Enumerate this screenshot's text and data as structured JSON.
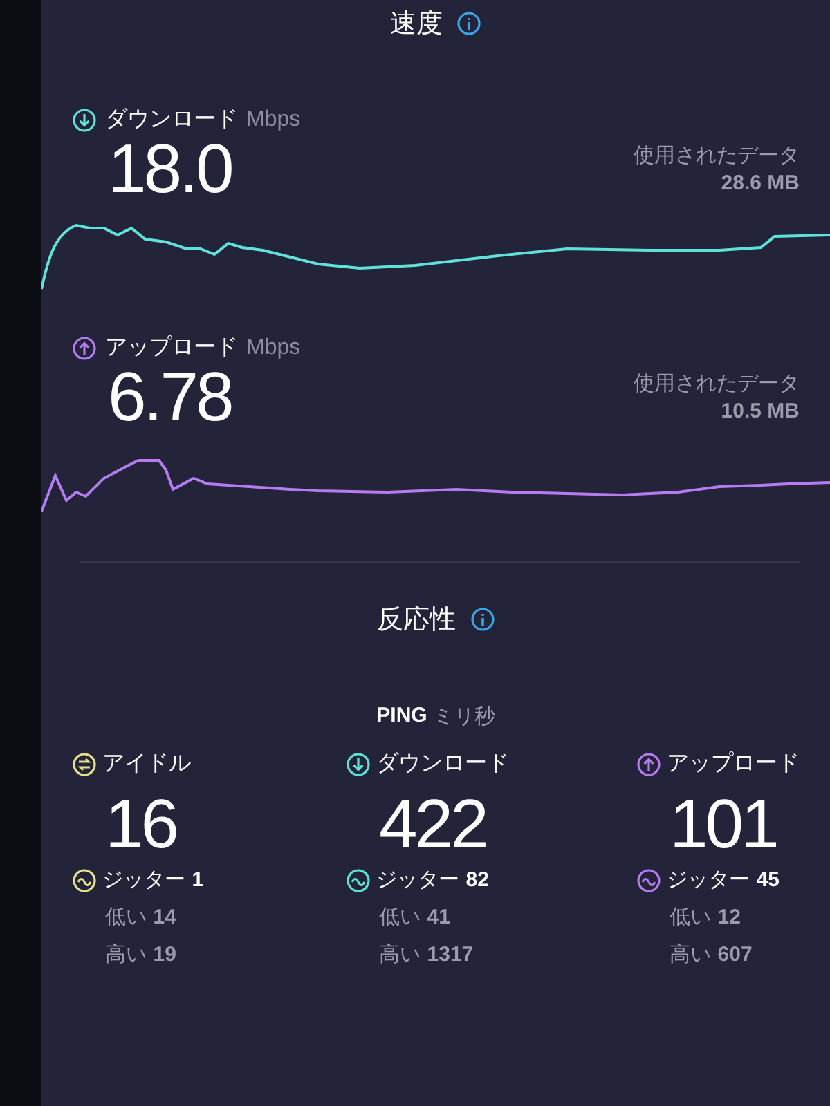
{
  "speed": {
    "title": "速度",
    "tests": [
      {
        "kind": "download",
        "label": "ダウンロード",
        "unit": "Mbps",
        "value": "18.0",
        "data_label": "使用されたデータ",
        "data_amount": "28.6 MB",
        "color": "#5fe3d8"
      },
      {
        "kind": "upload",
        "label": "アップロード",
        "unit": "Mbps",
        "value": "6.78",
        "data_label": "使用されたデータ",
        "data_amount": "10.5 MB",
        "color": "#b57cf2"
      }
    ]
  },
  "responsiveness": {
    "title": "反応性",
    "ping_label": "PING",
    "ping_unit": "ミリ秒",
    "columns": [
      {
        "kind": "idle",
        "label": "アイドル",
        "value": "16",
        "jitter_label": "ジッター",
        "jitter": "1",
        "low_label": "低い",
        "low": "14",
        "high_label": "高い",
        "high": "19",
        "color": "#e8e08a"
      },
      {
        "kind": "download",
        "label": "ダウンロード",
        "value": "422",
        "jitter_label": "ジッター",
        "jitter": "82",
        "low_label": "低い",
        "low": "41",
        "high_label": "高い",
        "high": "1317",
        "color": "#5fe3d8"
      },
      {
        "kind": "upload",
        "label": "アップロード",
        "value": "101",
        "jitter_label": "ジッター",
        "jitter": "45",
        "low_label": "低い",
        "low": "12",
        "high_label": "高い",
        "high": "607",
        "color": "#b57cf2"
      }
    ]
  }
}
